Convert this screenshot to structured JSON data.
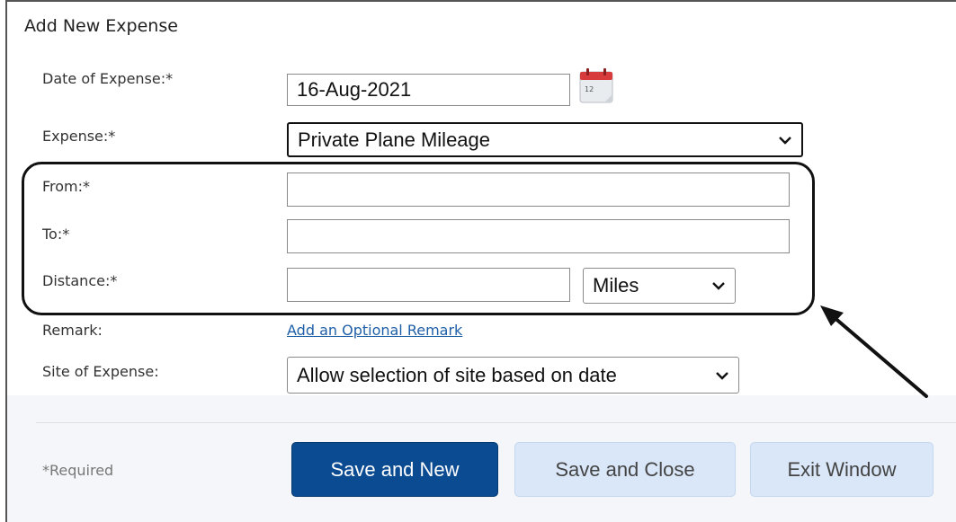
{
  "dialog": {
    "title": "Add New Expense"
  },
  "form": {
    "date": {
      "label": "Date of Expense:*",
      "value": "16-Aug-2021"
    },
    "expense": {
      "label": "Expense:*",
      "selected": "Private Plane Mileage"
    },
    "from": {
      "label": "From:*",
      "value": ""
    },
    "to": {
      "label": "To:*",
      "value": ""
    },
    "distance": {
      "label": "Distance:*",
      "value": "",
      "unit": "Miles"
    },
    "remark": {
      "label": "Remark:",
      "link": "Add an Optional Remark"
    },
    "site": {
      "label": "Site of Expense:",
      "selected": "Allow selection of site based on date"
    }
  },
  "footer": {
    "required_note": "*Required",
    "save_new": "Save and New",
    "save_close": "Save and Close",
    "exit": "Exit Window"
  },
  "icons": {
    "calendar": "calendar-icon",
    "dropdown": "chevron-down-icon",
    "annotation_arrow": "arrow-icon"
  },
  "colors": {
    "primary_button": "#0b4b92",
    "secondary_button": "#d9e7f8",
    "link": "#1f5fa8",
    "calendar_red": "#d83b3b"
  }
}
